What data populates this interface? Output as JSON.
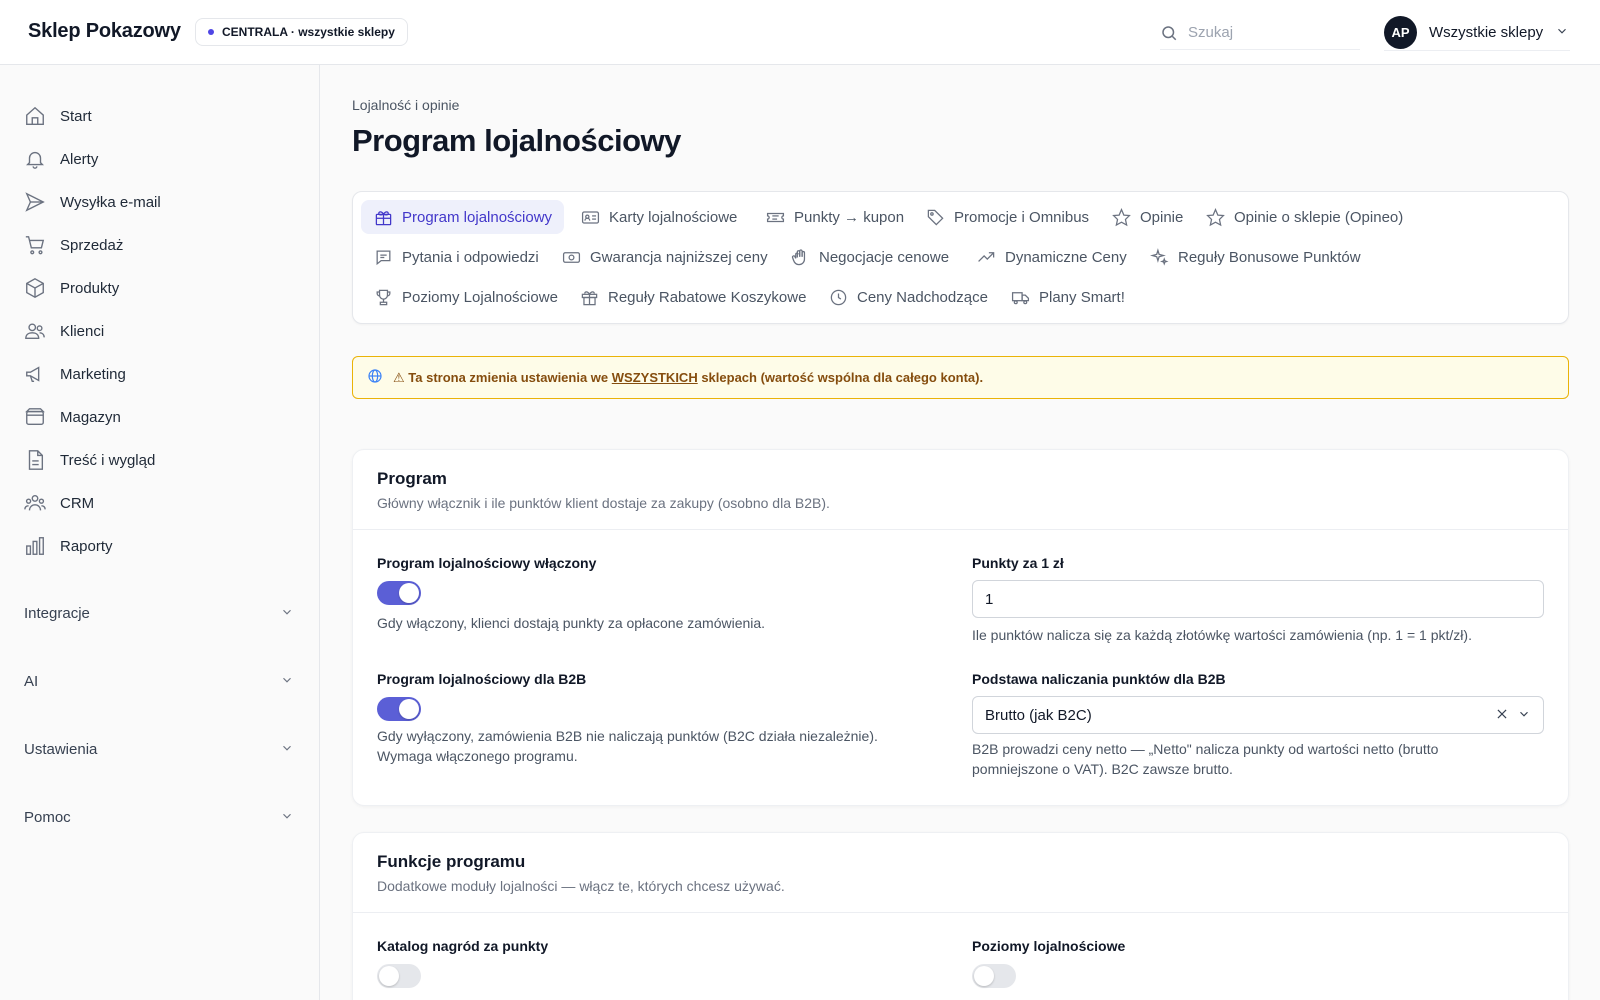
{
  "header": {
    "brand": "Sklep Pokazowy",
    "scope_badge": "CENTRALA · wszystkie sklepy",
    "search_placeholder": "Szukaj",
    "avatar_initials": "AP",
    "account_label": "Wszystkie sklepy"
  },
  "sidebar": {
    "items": [
      {
        "label": "Start",
        "icon": "home-icon"
      },
      {
        "label": "Alerty",
        "icon": "bell-icon"
      },
      {
        "label": "Wysyłka e-mail",
        "icon": "send-icon"
      },
      {
        "label": "Sprzedaż",
        "icon": "cart-icon"
      },
      {
        "label": "Produkty",
        "icon": "box-icon"
      },
      {
        "label": "Klienci",
        "icon": "users-icon"
      },
      {
        "label": "Marketing",
        "icon": "megaphone-icon"
      },
      {
        "label": "Magazyn",
        "icon": "warehouse-icon"
      },
      {
        "label": "Treść i wygląd",
        "icon": "document-icon"
      },
      {
        "label": "CRM",
        "icon": "group-icon"
      },
      {
        "label": "Raporty",
        "icon": "bar-chart-icon"
      }
    ],
    "groups": [
      {
        "label": "Integracje"
      },
      {
        "label": "AI"
      },
      {
        "label": "Ustawienia"
      },
      {
        "label": "Pomoc"
      }
    ]
  },
  "page": {
    "breadcrumb": "Lojalność i opinie",
    "title": "Program lojalnościowy"
  },
  "tabs": [
    {
      "label": "Program lojalnościowy",
      "icon": "gift-icon",
      "active": true
    },
    {
      "label": "Karty lojalnościowe",
      "icon": "id-card-icon"
    },
    {
      "label": "Punkty → kupon",
      "icon": "ticket-icon"
    },
    {
      "label": "Promocje i Omnibus",
      "icon": "tag-icon"
    },
    {
      "label": "Opinie",
      "icon": "star-icon"
    },
    {
      "label": "Opinie o sklepie (Opineo)",
      "icon": "star-icon"
    },
    {
      "label": "Pytania i odpowiedzi",
      "icon": "chat-icon"
    },
    {
      "label": "Gwarancja najniższej ceny",
      "icon": "banknote-icon"
    },
    {
      "label": "Negocjacje cenowe",
      "icon": "hand-icon"
    },
    {
      "label": "Dynamiczne Ceny",
      "icon": "trend-up-icon"
    },
    {
      "label": "Reguły Bonusowe Punktów",
      "icon": "sparkles-icon"
    },
    {
      "label": "Poziomy Lojalnościowe",
      "icon": "trophy-icon"
    },
    {
      "label": "Reguły Rabatowe Koszykowe",
      "icon": "gift-box-icon"
    },
    {
      "label": "Ceny Nadchodzące",
      "icon": "clock-icon"
    },
    {
      "label": "Plany Smart!",
      "icon": "truck-icon"
    }
  ],
  "alert": {
    "icon": "globe-icon",
    "prefix": "⚠ Ta strona zmienia ustawienia we ",
    "emphasis": "WSZYSTKICH",
    "suffix": " sklepach (wartość wspólna dla całego konta)."
  },
  "program_card": {
    "title": "Program",
    "subtitle": "Główny włącznik i ile punktów klient dostaje za zakupy (osobno dla B2B).",
    "enabled": {
      "label": "Program lojalnościowy włączony",
      "on": true,
      "help": "Gdy włączony, klienci dostają punkty za opłacone zamówienia."
    },
    "b2b": {
      "label": "Program lojalnościowy dla B2B",
      "on": true,
      "help_line1": "Gdy wyłączony, zamówienia B2B nie naliczają punktów (B2C działa niezależnie).",
      "help_line2": "Wymaga włączonego programu."
    },
    "points_per_pln": {
      "label": "Punkty za 1 zł",
      "value": "1",
      "help": "Ile punktów nalicza się za każdą złotówkę wartości zamówienia (np. 1 = 1 pkt/zł)."
    },
    "b2b_basis": {
      "label": "Podstawa naliczania punktów dla B2B",
      "value": "Brutto (jak B2C)",
      "help_line1": "B2B prowadzi ceny netto — „Netto\" nalicza punkty od wartości netto (brutto",
      "help_line2": "pomniejszone o VAT). B2C zawsze brutto."
    }
  },
  "features_card": {
    "title": "Funkcje programu",
    "subtitle": "Dodatkowe moduły lojalności — włącz te, których chcesz używać.",
    "rewards_catalog": {
      "label": "Katalog nagród za punkty",
      "on": false
    },
    "loyalty_tiers": {
      "label": "Poziomy lojalnościowe",
      "on": false
    }
  }
}
